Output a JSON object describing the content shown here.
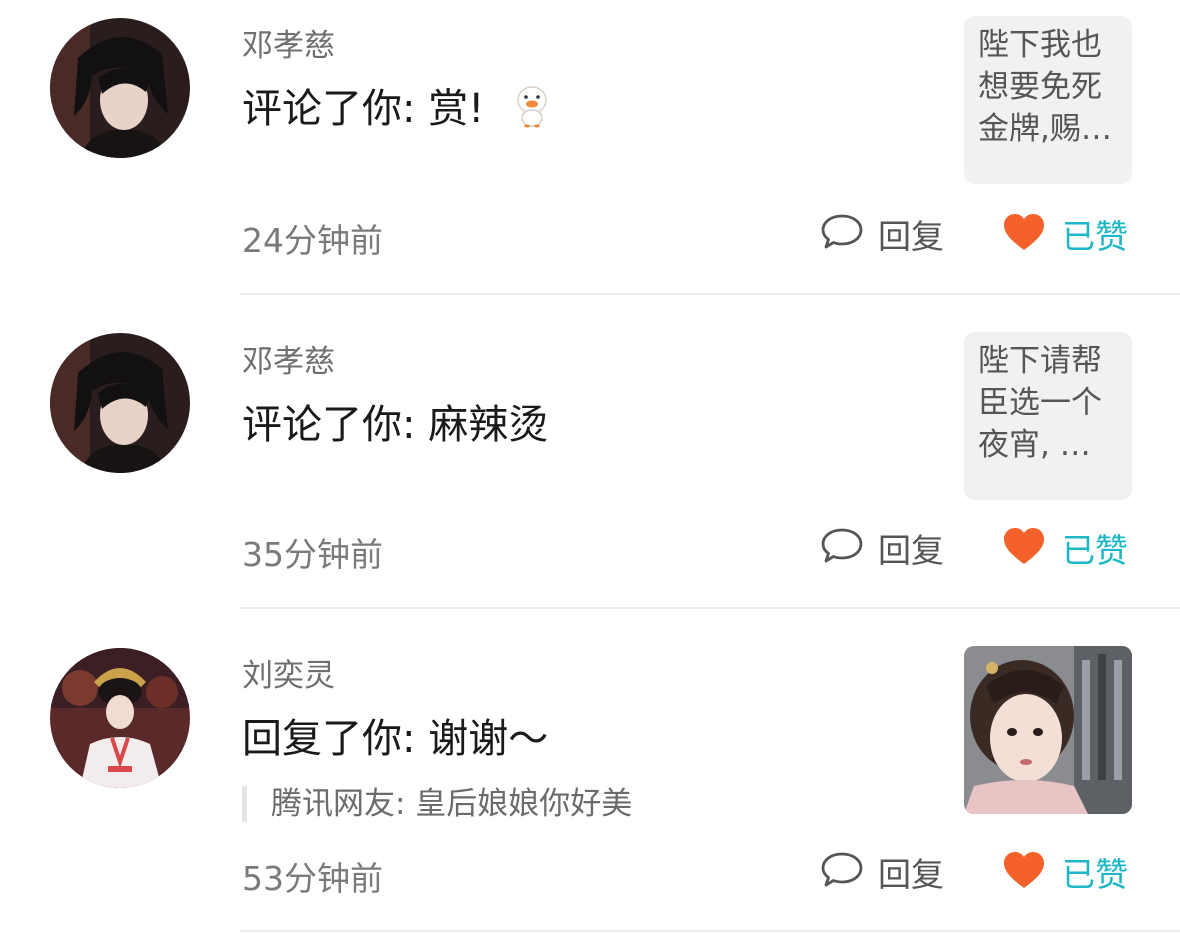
{
  "notifications": [
    {
      "user": "邓孝慈",
      "action": "评论了你: 赏!",
      "preview_lines": [
        "陛下我也",
        "想要免死",
        "金牌,赐…"
      ],
      "time": "24分钟前",
      "reply_label": "回复",
      "like_label": "已赞"
    },
    {
      "user": "邓孝慈",
      "action": "评论了你: 麻辣烫",
      "preview_lines": [
        "陛下请帮",
        "臣选一个",
        "夜宵, …"
      ],
      "time": "35分钟前",
      "reply_label": "回复",
      "like_label": "已赞"
    },
    {
      "user": "刘奕灵",
      "action": "回复了你: 谢谢～",
      "quote": "腾讯网友: 皇后娘娘你好美",
      "time": "53分钟前",
      "reply_label": "回复",
      "like_label": "已赞"
    }
  ],
  "colors": {
    "heart": "#f4612a",
    "liked_text": "#1fb7c7",
    "divider": "#ececec"
  },
  "icons": {
    "reply": "speech-bubble-icon",
    "like": "heart-icon",
    "emoji": "duck-emoji-icon"
  }
}
